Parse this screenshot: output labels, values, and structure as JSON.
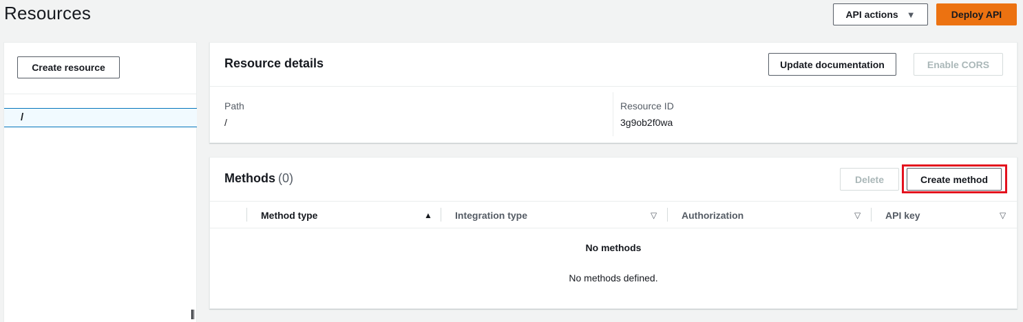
{
  "header": {
    "title": "Resources",
    "api_actions_label": "API actions",
    "deploy_label": "Deploy API"
  },
  "tree": {
    "create_resource_label": "Create resource",
    "items": [
      {
        "label": "/"
      }
    ]
  },
  "details": {
    "title": "Resource details",
    "update_doc_label": "Update documentation",
    "enable_cors_label": "Enable CORS",
    "path_label": "Path",
    "path_value": "/",
    "resource_id_label": "Resource ID",
    "resource_id_value": "3g9ob2f0wa"
  },
  "methods": {
    "title": "Methods",
    "count": "(0)",
    "delete_label": "Delete",
    "create_method_label": "Create method",
    "columns": [
      "Method type",
      "Integration type",
      "Authorization",
      "API key"
    ],
    "empty_title": "No methods",
    "empty_message": "No methods defined."
  },
  "colors": {
    "primary": "#ec7211",
    "selected_border": "#0073bb",
    "highlight": "#e3101d"
  }
}
